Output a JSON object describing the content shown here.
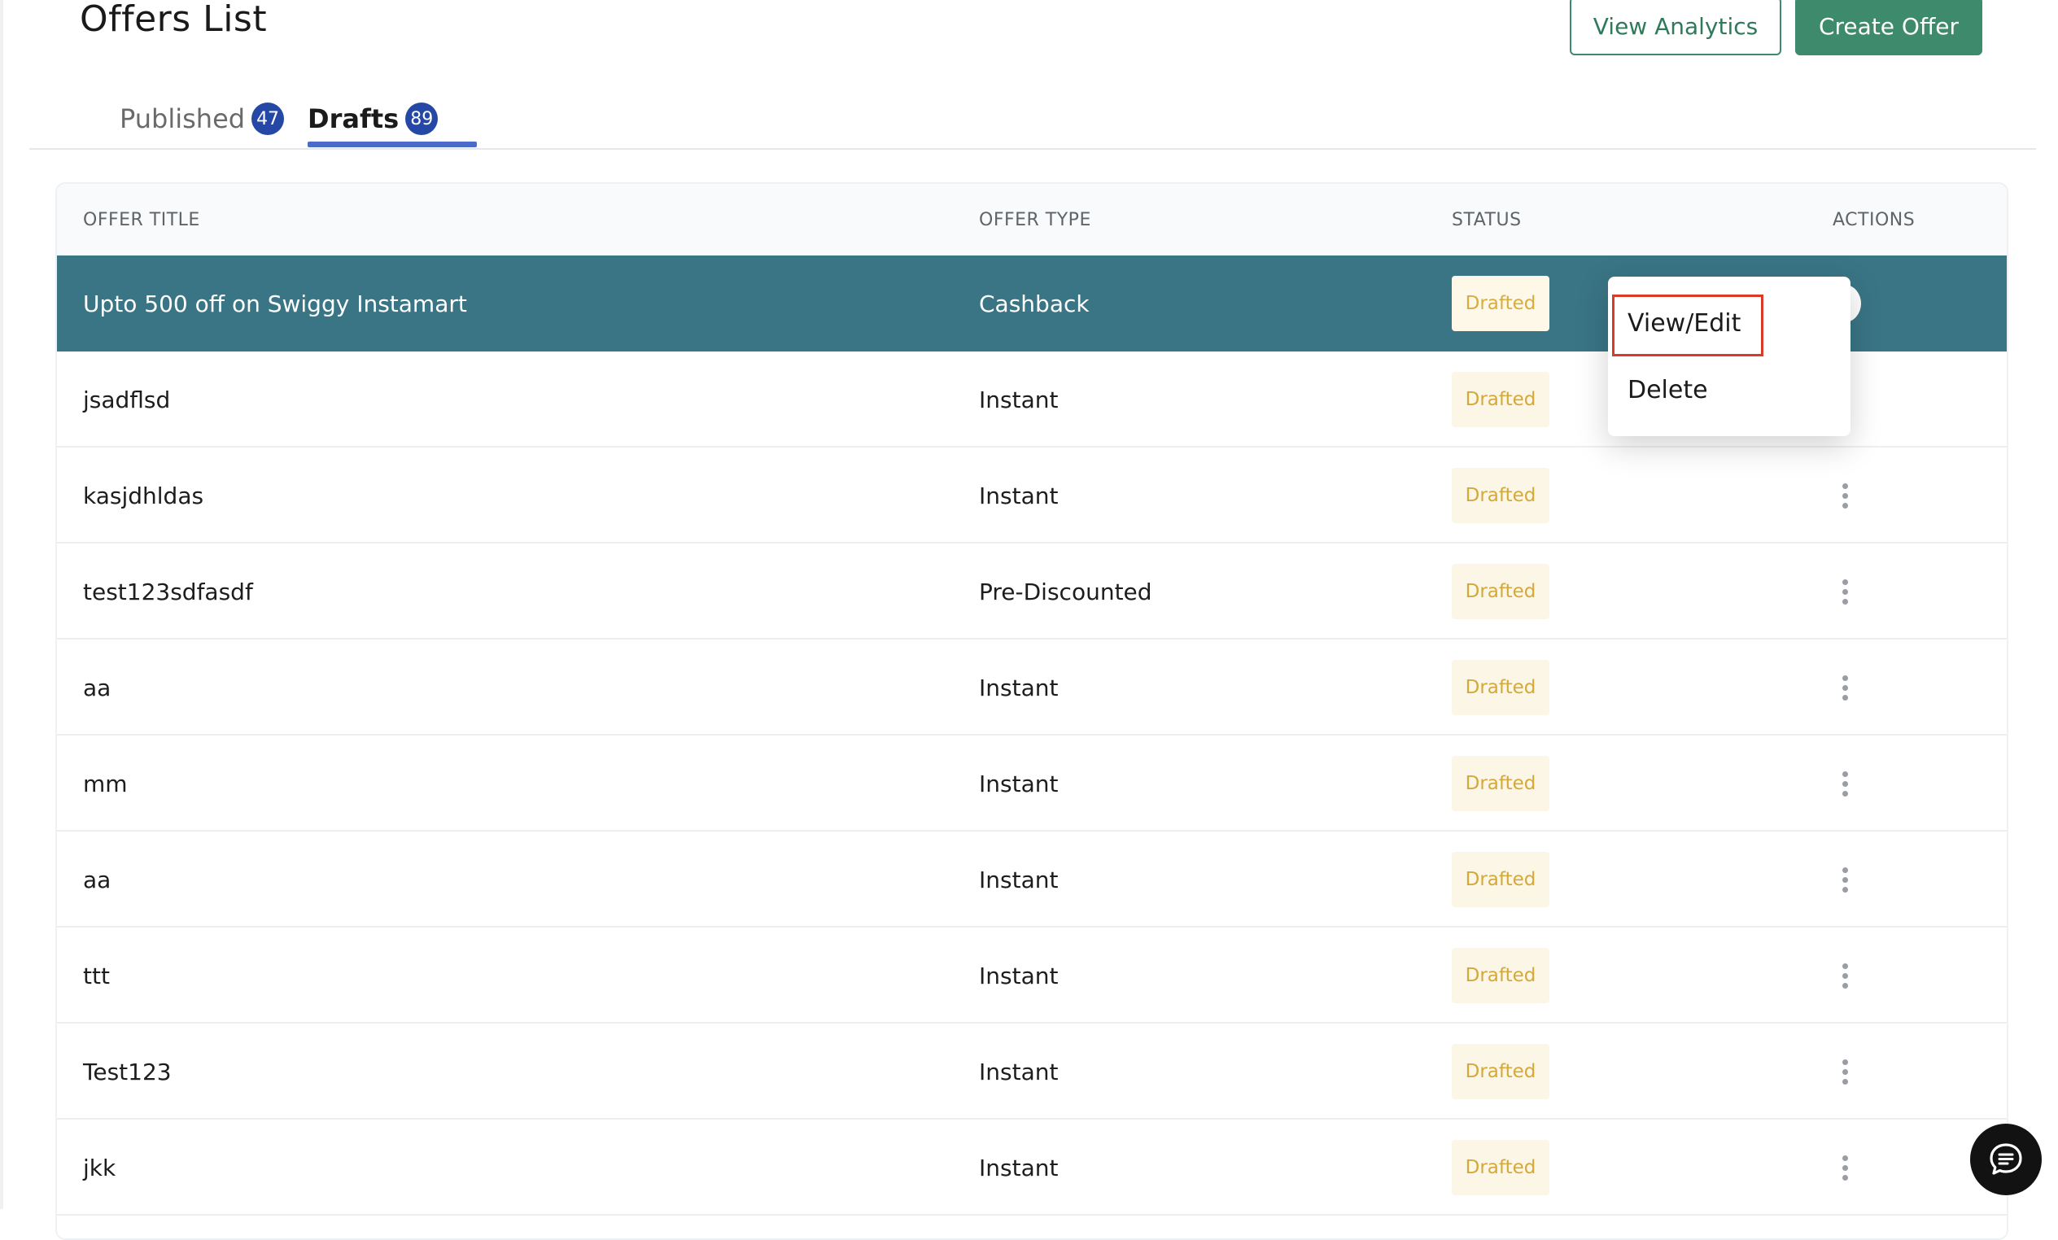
{
  "header": {
    "title": "Offers List",
    "view_analytics_label": "View Analytics",
    "create_offer_label": "Create Offer"
  },
  "tabs": [
    {
      "label": "Published",
      "count": "47",
      "active": false
    },
    {
      "label": "Drafts",
      "count": "89",
      "active": true
    }
  ],
  "table": {
    "columns": [
      "OFFER TITLE",
      "OFFER TYPE",
      "STATUS",
      "ACTIONS"
    ],
    "rows": [
      {
        "title": "Upto 500 off on Swiggy Instamart",
        "type": "Cashback",
        "status": "Drafted"
      },
      {
        "title": "jsadflsd",
        "type": "Instant",
        "status": "Drafted"
      },
      {
        "title": "kasjdhldas",
        "type": "Instant",
        "status": "Drafted"
      },
      {
        "title": "test123sdfasdf",
        "type": "Pre-Discounted",
        "status": "Drafted"
      },
      {
        "title": "aa",
        "type": "Instant",
        "status": "Drafted"
      },
      {
        "title": "mm",
        "type": "Instant",
        "status": "Drafted"
      },
      {
        "title": "aa",
        "type": "Instant",
        "status": "Drafted"
      },
      {
        "title": "ttt",
        "type": "Instant",
        "status": "Drafted"
      },
      {
        "title": "Test123",
        "type": "Instant",
        "status": "Drafted"
      },
      {
        "title": "jkk",
        "type": "Instant",
        "status": "Drafted"
      }
    ]
  },
  "actions_menu": {
    "items": [
      "View/Edit",
      "Delete"
    ]
  },
  "colors": {
    "primary": "#3d8a6c",
    "selected_row": "#3a7585",
    "tab_accent": "#4a6cc8",
    "badge_bg": "#2547a5",
    "status_text": "#d4a93a",
    "status_bg": "#fbf6e6",
    "highlight": "#d93a2a"
  },
  "icons": {
    "row_actions": "kebab-vertical-icon",
    "chat": "chat-bubble-icon"
  }
}
